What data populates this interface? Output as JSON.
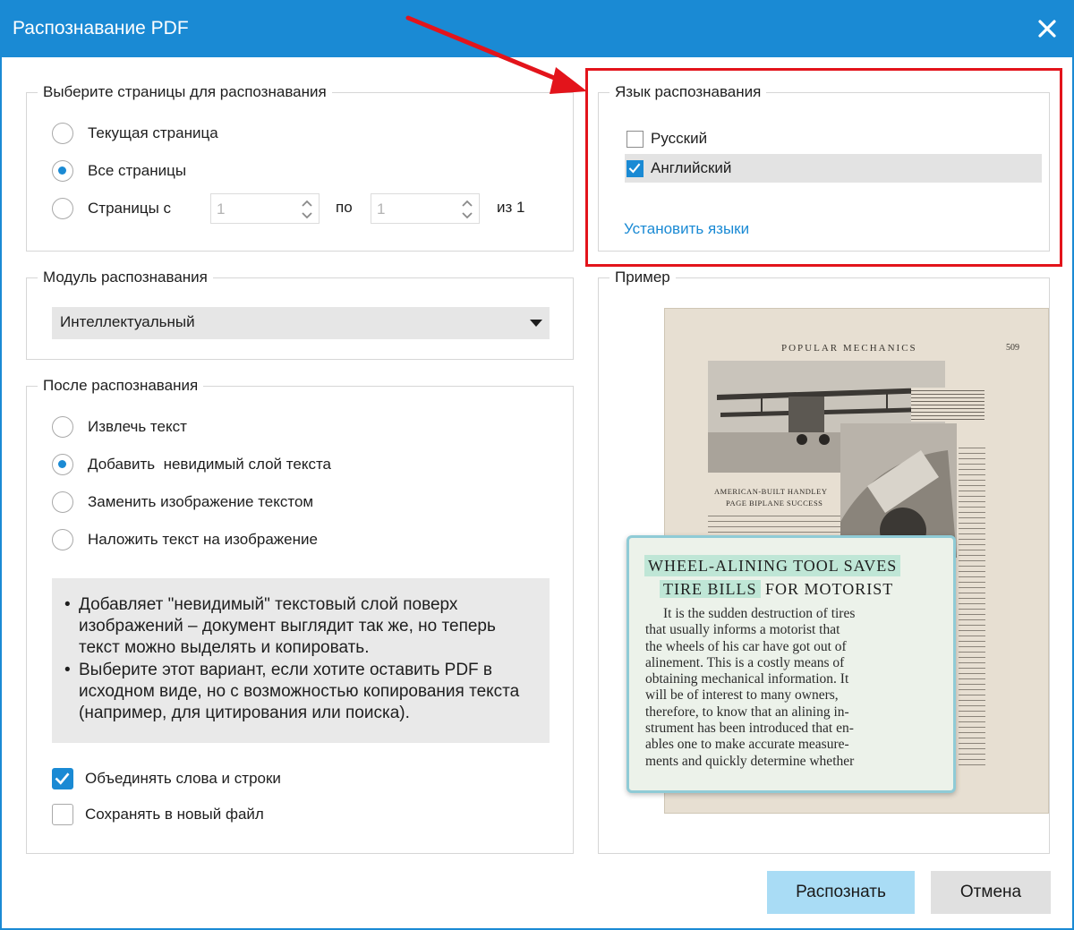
{
  "window": {
    "title": "Распознавание PDF",
    "close_icon": "close-icon"
  },
  "pages_group": {
    "legend": "Выберите страницы для распознавания",
    "options": [
      {
        "label": "Текущая страница",
        "checked": false
      },
      {
        "label": "Все страницы",
        "checked": true
      },
      {
        "label": "Страницы с",
        "checked": false
      }
    ],
    "from_value": "1",
    "to_label": "по",
    "to_value": "1",
    "of_label": "из 1"
  },
  "module_group": {
    "legend": "Модуль распознавания",
    "selected": "Интеллектуальный"
  },
  "after_group": {
    "legend": "После распознавания",
    "options": [
      {
        "label": "Извлечь текст",
        "checked": false
      },
      {
        "label": "Добавить  невидимый слой текста",
        "checked": true
      },
      {
        "label": "Заменить изображение текстом",
        "checked": false
      },
      {
        "label": "Наложить текст на изображение",
        "checked": false
      }
    ],
    "description": [
      "Добавляет \"невидимый\" текстовый слой поверх изображений – документ выглядит так же, но теперь текст можно выделять и копировать.",
      "Выберите этот вариант, если хотите оставить PDF в исходном виде, но с возможностью копирования текста (например, для цитирования или поиска)."
    ],
    "merge_label": "Объединять слова и строки",
    "merge_checked": true,
    "save_new_label": "Сохранять в новый файл",
    "save_new_checked": false
  },
  "language_group": {
    "legend": "Язык распознавания",
    "languages": [
      {
        "label": "Русский",
        "checked": false
      },
      {
        "label": "Английский",
        "checked": true
      }
    ],
    "install_link": "Установить языки"
  },
  "preview_group": {
    "legend": "Пример",
    "page_header": "POPULAR MECHANICS",
    "page_number": "509",
    "photo_caption_1": "AMERICAN-BUILT HANDLEY",
    "photo_caption_2": "PAGE BIPLANE SUCCESS",
    "zoom_heading_1": "WHEEL-ALINING TOOL SAVES",
    "zoom_heading_2a": "TIRE BILLS",
    "zoom_heading_2b": "FOR MOTORIST",
    "zoom_body": [
      "It is the sudden destruction of tires",
      "that usually informs a motorist that",
      "the wheels of his car have got out of",
      "alinement. This is a costly means of",
      "obtaining mechanical information. It",
      "will be of interest to many owners,",
      "therefore, to know that an alining in-",
      "strument has been introduced that en-",
      "ables one to make accurate measure-",
      "ments and quickly determine whether"
    ]
  },
  "buttons": {
    "recognize": "Распознать",
    "cancel": "Отмена"
  },
  "colors": {
    "accent": "#1a8ad4",
    "highlight_frame": "#e3141b",
    "primary_button": "#a9dcf5"
  }
}
